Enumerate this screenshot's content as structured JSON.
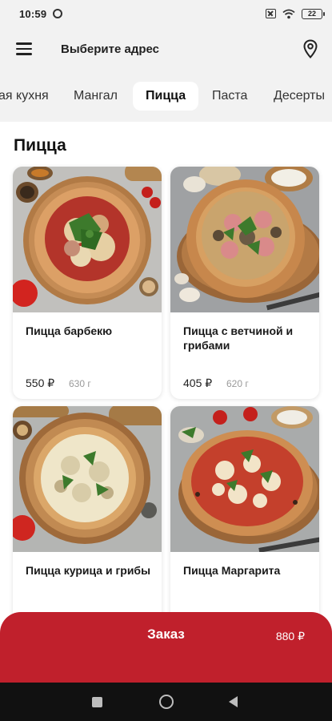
{
  "status_bar": {
    "time": "10:59",
    "battery": "22"
  },
  "header": {
    "address_label": "Выберите адрес"
  },
  "tabs": [
    {
      "label": "ая кухня",
      "active": false
    },
    {
      "label": "Мангал",
      "active": false
    },
    {
      "label": "Пицца",
      "active": true
    },
    {
      "label": "Паста",
      "active": false
    },
    {
      "label": "Десерты",
      "active": false
    }
  ],
  "section": {
    "title": "Пицца"
  },
  "products": [
    {
      "name": "Пицца барбекю",
      "price": "550 ₽",
      "weight": "630 г"
    },
    {
      "name": "Пицца с ветчиной и грибами",
      "price": "405 ₽",
      "weight": "620 г"
    },
    {
      "name": "Пицца курица и грибы",
      "price": "",
      "weight": ""
    },
    {
      "name": "Пицца Маргарита",
      "price": "",
      "weight": ""
    }
  ],
  "order_bar": {
    "label": "Заказ",
    "total": "880 ₽"
  },
  "colors": {
    "accent": "#c0202c",
    "header_bg": "#f2f2f2",
    "nav_bg": "#111111"
  },
  "icons": [
    "settings-icon",
    "notification-off-icon",
    "wifi-icon",
    "battery-icon",
    "menu-icon",
    "location-pin-icon",
    "recent-apps-icon",
    "home-icon",
    "back-icon"
  ]
}
